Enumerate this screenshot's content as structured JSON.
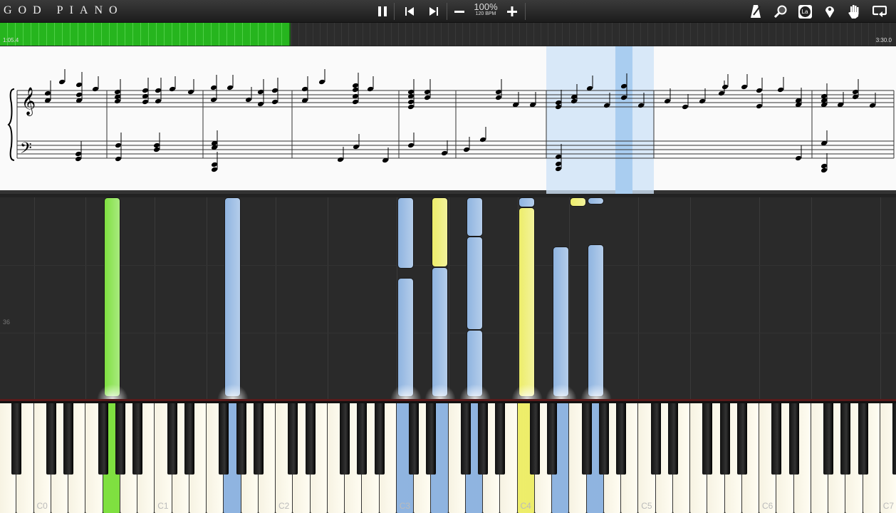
{
  "app": {
    "title": "GOD PIANO"
  },
  "toolbar": {
    "zoom": "100%",
    "bpm": "120 BPM",
    "icons": [
      "pause-icon",
      "skip-back-icon",
      "skip-forward-icon",
      "minus-icon",
      "plus-icon",
      "metronome-icon",
      "search-icon",
      "note-name-icon",
      "marker-icon",
      "hand-icon",
      "loop-icon"
    ],
    "note_name_label": "La"
  },
  "timeline": {
    "current": "1:05.4",
    "total": "3:30.0",
    "progress_percent": 32.4
  },
  "roll": {
    "measure_label": "36"
  },
  "colors": {
    "left_hand": "#8fb4e0",
    "right_hand": "#eded6a",
    "green": "#7fe040",
    "accent": "#26b51e"
  },
  "keyboard": {
    "octave_labels": [
      "C0",
      "C1",
      "C2",
      "C3",
      "C4",
      "C5",
      "C6",
      "C7"
    ],
    "pressed": [
      {
        "key": "G0",
        "track": "green"
      },
      {
        "key": "G1",
        "track": "blue"
      },
      {
        "key": "C3",
        "track": "blue"
      },
      {
        "key": "E3",
        "track": "blue"
      },
      {
        "key": "G3",
        "track": "blue"
      },
      {
        "key": "C4",
        "track": "yellow"
      },
      {
        "key": "E4",
        "track": "blue"
      },
      {
        "key": "G4",
        "track": "blue"
      }
    ]
  }
}
